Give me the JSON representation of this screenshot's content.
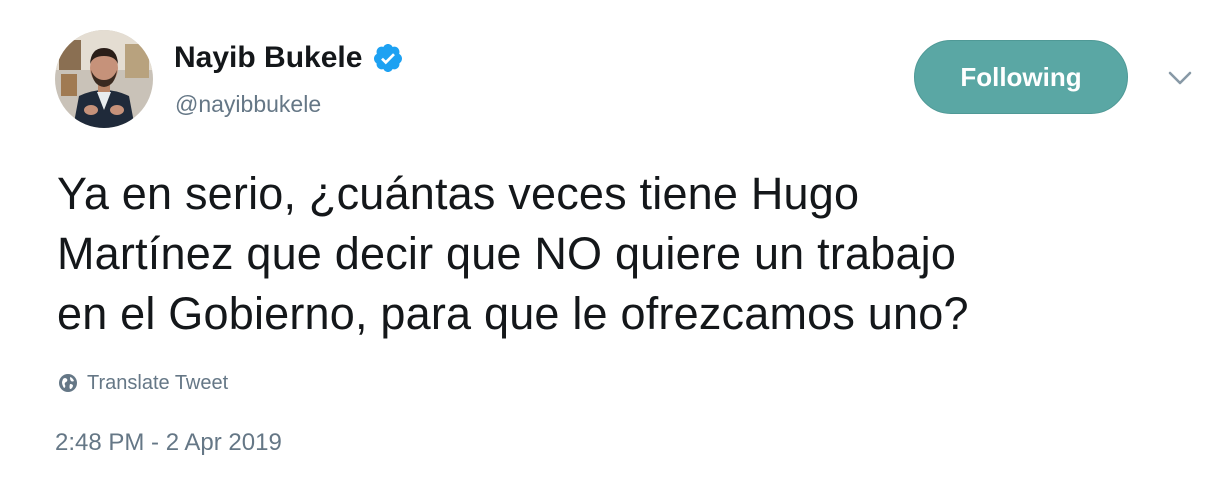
{
  "author": {
    "display_name": "Nayib Bukele",
    "handle": "@nayibbukele",
    "verified": true,
    "verified_color": "#1da1f2"
  },
  "follow_button": {
    "label": "Following",
    "color": "#5aa7a4"
  },
  "menu": {
    "icon": "chevron-down-icon"
  },
  "tweet": {
    "text": "Ya en serio, ¿cuántas veces tiene Hugo\nMartínez que decir que NO quiere un trabajo\nen el Gobierno, para que le ofrezcamos uno?",
    "translate_label": "Translate Tweet",
    "translate_icon": "globe-icon",
    "timestamp": "2:48 PM - 2 Apr 2019"
  },
  "colors": {
    "text": "#14171a",
    "secondary_text": "#657786"
  }
}
